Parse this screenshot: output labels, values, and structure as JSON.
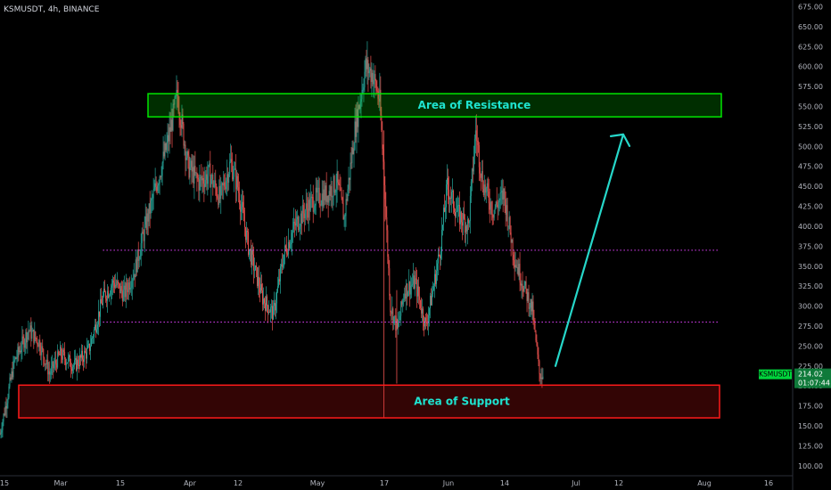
{
  "header": {
    "symbol_line": "KSMUSDT, 4h, BINANCE"
  },
  "chart_data": {
    "type": "candlestick",
    "title": "KSMUSDT, 4h, BINANCE",
    "xlabel": "",
    "ylabel": "",
    "ylim": [
      92,
      680
    ],
    "x_ticks": [
      "15",
      "Mar",
      "15",
      "Apr",
      "12",
      "May",
      "17",
      "Jun",
      "14",
      "Jul",
      "12",
      "Aug",
      "16"
    ],
    "y_ticks": [
      100,
      125,
      150,
      175,
      200,
      225,
      250,
      275,
      300,
      325,
      350,
      375,
      400,
      425,
      450,
      475,
      500,
      525,
      550,
      575,
      600,
      625,
      650,
      675
    ],
    "y_tick_labels": [
      "100.00",
      "125.00",
      "150.00",
      "175.00",
      "200.00",
      "225.00",
      "250.00",
      "275.00",
      "300.00",
      "325.00",
      "350.00",
      "375.00",
      "400.00",
      "425.00",
      "450.00",
      "475.00",
      "500.00",
      "525.00",
      "550.00",
      "575.00",
      "600.00",
      "625.00",
      "650.00",
      "675.00"
    ],
    "price_path": [
      {
        "t": 0,
        "p": 140
      },
      {
        "t": 4,
        "p": 230
      },
      {
        "t": 8,
        "p": 270
      },
      {
        "t": 11,
        "p": 255
      },
      {
        "t": 14,
        "p": 215
      },
      {
        "t": 17,
        "p": 240
      },
      {
        "t": 21,
        "p": 225
      },
      {
        "t": 25,
        "p": 245
      },
      {
        "t": 29,
        "p": 310
      },
      {
        "t": 32,
        "p": 330
      },
      {
        "t": 35,
        "p": 315
      },
      {
        "t": 38,
        "p": 345
      },
      {
        "t": 41,
        "p": 400
      },
      {
        "t": 44,
        "p": 450
      },
      {
        "t": 47,
        "p": 500
      },
      {
        "t": 50,
        "p": 565
      },
      {
        "t": 53,
        "p": 475
      },
      {
        "t": 56,
        "p": 455
      },
      {
        "t": 59,
        "p": 465
      },
      {
        "t": 62,
        "p": 435
      },
      {
        "t": 65,
        "p": 480
      },
      {
        "t": 67,
        "p": 450
      },
      {
        "t": 70,
        "p": 375
      },
      {
        "t": 74,
        "p": 310
      },
      {
        "t": 77,
        "p": 290
      },
      {
        "t": 80,
        "p": 365
      },
      {
        "t": 83,
        "p": 400
      },
      {
        "t": 86,
        "p": 420
      },
      {
        "t": 89,
        "p": 435
      },
      {
        "t": 92,
        "p": 440
      },
      {
        "t": 95,
        "p": 455
      },
      {
        "t": 97,
        "p": 410
      },
      {
        "t": 100,
        "p": 520
      },
      {
        "t": 103,
        "p": 600
      },
      {
        "t": 105,
        "p": 590
      },
      {
        "t": 107,
        "p": 555
      },
      {
        "t": 108,
        "p": 480
      },
      {
        "t": 110,
        "p": 300
      },
      {
        "t": 112,
        "p": 270
      },
      {
        "t": 114,
        "p": 320
      },
      {
        "t": 117,
        "p": 330
      },
      {
        "t": 120,
        "p": 275
      },
      {
        "t": 122,
        "p": 320
      },
      {
        "t": 124,
        "p": 370
      },
      {
        "t": 126,
        "p": 450
      },
      {
        "t": 129,
        "p": 415
      },
      {
        "t": 132,
        "p": 400
      },
      {
        "t": 134,
        "p": 520
      },
      {
        "t": 136,
        "p": 455
      },
      {
        "t": 139,
        "p": 420
      },
      {
        "t": 142,
        "p": 440
      },
      {
        "t": 145,
        "p": 360
      },
      {
        "t": 148,
        "p": 320
      },
      {
        "t": 150,
        "p": 295
      },
      {
        "t": 152,
        "p": 215
      },
      {
        "t": 153,
        "p": 214
      }
    ],
    "levels": [
      {
        "value": 370,
        "style": "dotted",
        "color": "#e040fb"
      },
      {
        "value": 280,
        "style": "dotted",
        "color": "#e040fb"
      }
    ],
    "zones": [
      {
        "label": "Area of Resistance",
        "from": 537,
        "to": 566,
        "color": "#00e600"
      },
      {
        "label": "Area of Support",
        "from": 160,
        "to": 201,
        "color": "#ff1a1a"
      }
    ],
    "arrow": {
      "from": {
        "t": 155,
        "p": 225
      },
      "to": {
        "t": 175,
        "p": 515
      },
      "color": "#26d7c9"
    },
    "last_price": {
      "symbol": "KSMUSDT",
      "value": "214.02",
      "countdown": "01:07:44"
    },
    "colors": {
      "up": "#26a69a",
      "down": "#ef5350",
      "axis_text": "#b2b5be",
      "label_text": "#1ee3d0"
    },
    "grid": false,
    "legend": "none"
  }
}
